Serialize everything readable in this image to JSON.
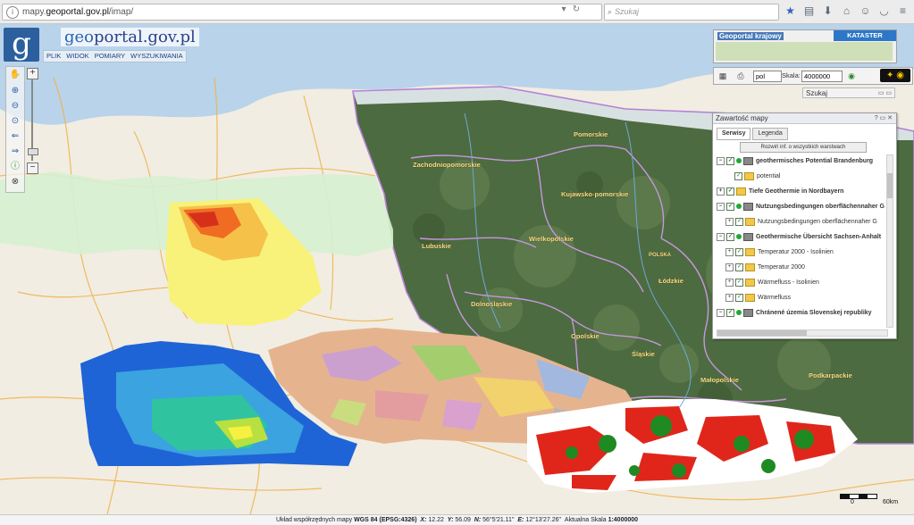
{
  "browser": {
    "url_prefix": "mapy.",
    "url_host": "geoportal.gov.pl",
    "url_path": "/imap/",
    "search_placeholder": "Szukaj"
  },
  "header": {
    "logo_text_a": "geo",
    "logo_text_b": "portal.gov.pl",
    "menu": [
      "PLIK",
      "WIDOK",
      "POMIARY",
      "WYSZUKIWANIA"
    ]
  },
  "toolbar": {
    "zoom_in": "+",
    "zoom_out": "−"
  },
  "kraj_panel": {
    "title": "Geoportal krajowy",
    "kataster": "KATASTER"
  },
  "scale_panel": {
    "lang": "pol",
    "scale_label": "Skala:",
    "scale_value": "4000000"
  },
  "search_panel": {
    "title": "Szukaj"
  },
  "content_panel": {
    "title": "Zawartość mapy",
    "tabs": [
      "Serwisy",
      "Legenda"
    ],
    "expand_button": "Rozwiń inf. o wszystkich warstwach",
    "layers": [
      {
        "name": "geothermisches Potential Brandenburg",
        "bold": true
      },
      {
        "name": "potential",
        "bold": false
      },
      {
        "name": "Tiefe Geothermie in Nordbayern",
        "bold": true
      },
      {
        "name": "Nutzungsbedingungen oberflächennaher G",
        "bold": true
      },
      {
        "name": "Nutzungsbedingungen oberflächennaher G",
        "bold": false
      },
      {
        "name": "Geothermische Übersicht Sachsen-Anhalt",
        "bold": true
      },
      {
        "name": "Temperatur 2000 - Isolinien",
        "bold": false
      },
      {
        "name": "Temperatur 2000",
        "bold": false
      },
      {
        "name": "Wärmefluss - Isolinien",
        "bold": false
      },
      {
        "name": "Wärmefluss",
        "bold": false
      },
      {
        "name": "Chránené územia Slovenskej republiky",
        "bold": true
      }
    ]
  },
  "map_labels": {
    "pomorskie": "Pomorskie",
    "zachodniopomorskie": "Zachodniopomorskie",
    "kujawsko": "Kujawsko-pomorskie",
    "lubuskie": "Lubuskie",
    "wielkopolskie": "Wielkopolskie",
    "polska": "POLSKA",
    "lodzkie": "Łódzkie",
    "dolnoslaskie": "Dolnośląskie",
    "opolskie": "Opolskie",
    "slaskie": "Śląskie",
    "malopolskie": "Małopolskie",
    "podkarpackie": "Podkarpackie"
  },
  "map_scale": {
    "zero": "0",
    "max": "60km"
  },
  "status": {
    "crs_label": "Układ współrzędnych mapy",
    "crs_value": "WGS 84 (EPSG:4326)",
    "x_label": "X:",
    "x_value": "12.22",
    "y_label": "Y:",
    "y_value": "56.09",
    "n_label": "N:",
    "n_value": "56°5'21.11\"",
    "e_label": "E:",
    "e_value": "12°13'27.26\"",
    "scale_label": "Aktualna Skala",
    "scale_value": "1:4000000"
  },
  "colors": {
    "brand_blue": "#2c5f9e",
    "kataster": "#2c77c8",
    "eye_bg": "#111111",
    "eye_fg": "#f6c400"
  }
}
